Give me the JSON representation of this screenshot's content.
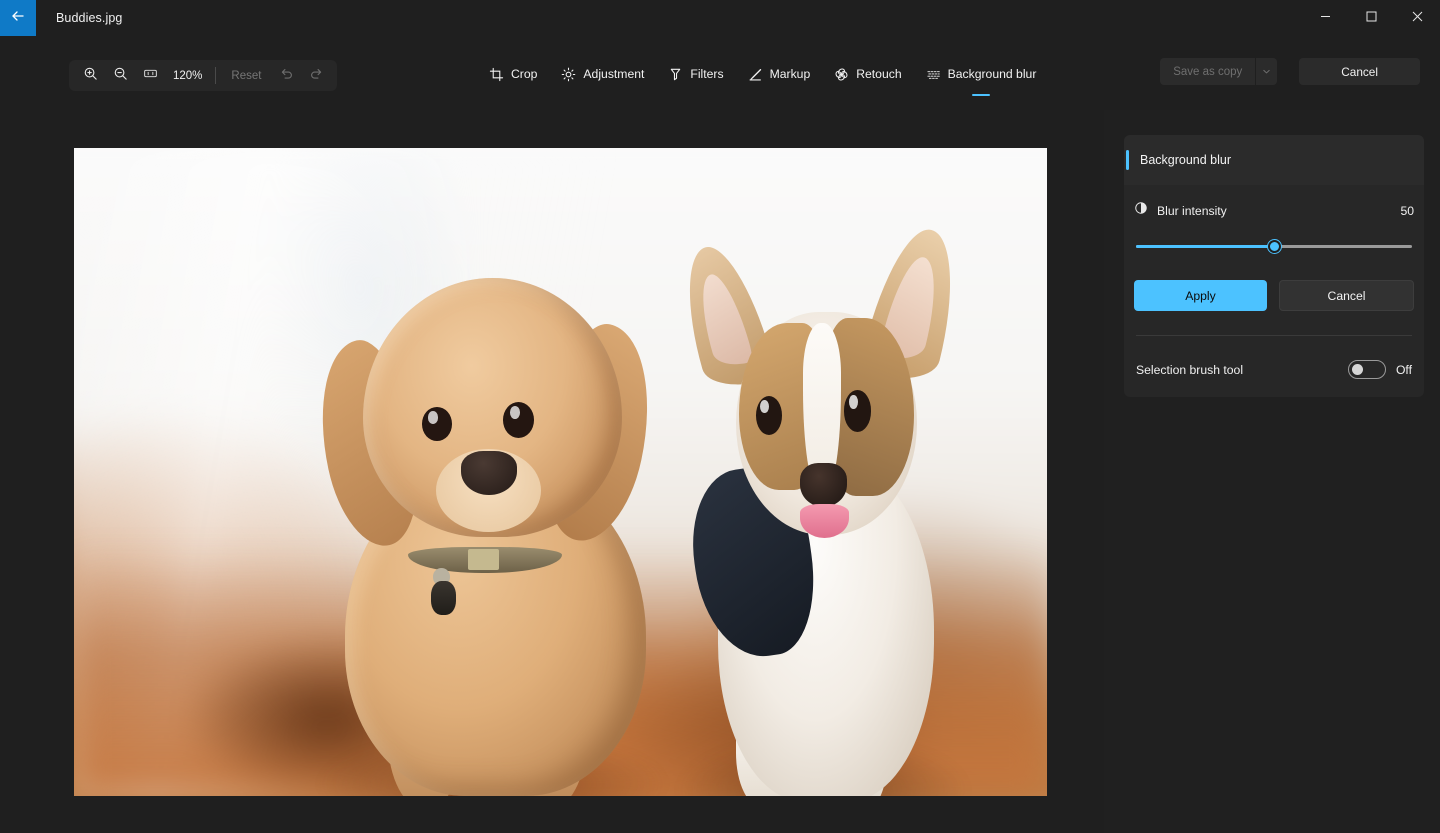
{
  "titlebar": {
    "back_icon": "arrow-left-icon",
    "document_title": "Buddies.jpg",
    "window_controls": {
      "minimize": "minimize-icon",
      "maximize": "maximize-icon",
      "close": "close-icon"
    }
  },
  "toolbar": {
    "zoom_in_icon": "zoom-in-icon",
    "zoom_out_icon": "zoom-out-icon",
    "fit_icon": "actual-size-icon",
    "zoom_level": "120%",
    "reset_label": "Reset",
    "undo_icon": "undo-icon",
    "redo_icon": "redo-icon"
  },
  "tabs": [
    {
      "label": "Crop",
      "icon": "crop-icon",
      "active": false
    },
    {
      "label": "Adjustment",
      "icon": "brightness-icon",
      "active": false
    },
    {
      "label": "Filters",
      "icon": "filters-icon",
      "active": false
    },
    {
      "label": "Markup",
      "icon": "pen-icon",
      "active": false
    },
    {
      "label": "Retouch",
      "icon": "retouch-icon",
      "active": false
    },
    {
      "label": "Background blur",
      "icon": "blur-icon",
      "active": true
    }
  ],
  "actions": {
    "save_as_copy_label": "Save as copy",
    "save_chevron_icon": "chevron-down-icon",
    "cancel_label": "Cancel"
  },
  "image": {
    "alt": "Two puppies — a golden doodle and a corgi — sitting on an orange leather couch",
    "zoom": "120%"
  },
  "panel": {
    "title": "Background blur",
    "intensity": {
      "icon": "contrast-icon",
      "label": "Blur intensity",
      "value": "50",
      "percent": 50,
      "min": 0,
      "max": 100
    },
    "apply_label": "Apply",
    "cancel_label": "Cancel",
    "brush": {
      "label": "Selection brush tool",
      "state": "Off",
      "enabled": false
    }
  },
  "colors": {
    "accent": "#4cc2ff",
    "back_button": "#0f7ac7",
    "app_bg": "#1f1f1f",
    "panel_bg": "#202020",
    "card_bg": "#272727"
  }
}
